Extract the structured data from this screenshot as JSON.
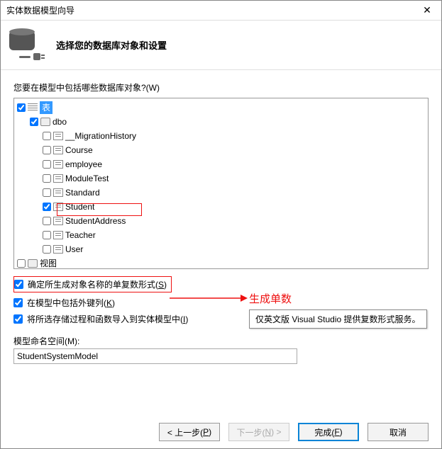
{
  "window": {
    "title": "实体数据模型向导",
    "close": "✕"
  },
  "header": {
    "title": "选择您的数据库对象和设置"
  },
  "prompt": "您要在模型中包括哪些数据库对象?(W)",
  "tree": {
    "root": {
      "label": "表",
      "checked": true
    },
    "schema": {
      "label": "dbo",
      "checked": true
    },
    "tables": [
      {
        "label": "__MigrationHistory",
        "checked": false
      },
      {
        "label": "Course",
        "checked": false
      },
      {
        "label": "employee",
        "checked": false
      },
      {
        "label": "ModuleTest",
        "checked": false
      },
      {
        "label": "Standard",
        "checked": false
      },
      {
        "label": "Student",
        "checked": true
      },
      {
        "label": "StudentAddress",
        "checked": false
      },
      {
        "label": "Teacher",
        "checked": false
      },
      {
        "label": "User",
        "checked": false
      }
    ],
    "views": {
      "label": "视图",
      "checked": false
    }
  },
  "options": {
    "opt1": {
      "label_prefix": "确定所生成对象名称的单复数形式(",
      "key": "S",
      "label_suffix": ")",
      "checked": true
    },
    "opt2": {
      "label_prefix": "在模型中包括外键列(",
      "key": "K",
      "label_suffix": ")",
      "checked": true
    },
    "opt3": {
      "label_prefix": "将所选存储过程和函数导入到实体模型中(",
      "key": "I",
      "label_suffix": ")",
      "checked": true
    }
  },
  "annotation": {
    "text": "生成单数"
  },
  "tooltip": {
    "text": "仅英文版 Visual Studio 提供复数形式服务。"
  },
  "namespace": {
    "label_prefix": "模型命名空间(",
    "key": "M",
    "label_suffix": "):",
    "value": "StudentSystemModel"
  },
  "buttons": {
    "back": {
      "prefix": "< 上一步(",
      "key": "P",
      "suffix": ")"
    },
    "next": {
      "prefix": "下一步(",
      "key": "N",
      "suffix": ") >"
    },
    "finish": {
      "prefix": "完成(",
      "key": "F",
      "suffix": ")"
    },
    "cancel": {
      "label": "取消"
    }
  }
}
